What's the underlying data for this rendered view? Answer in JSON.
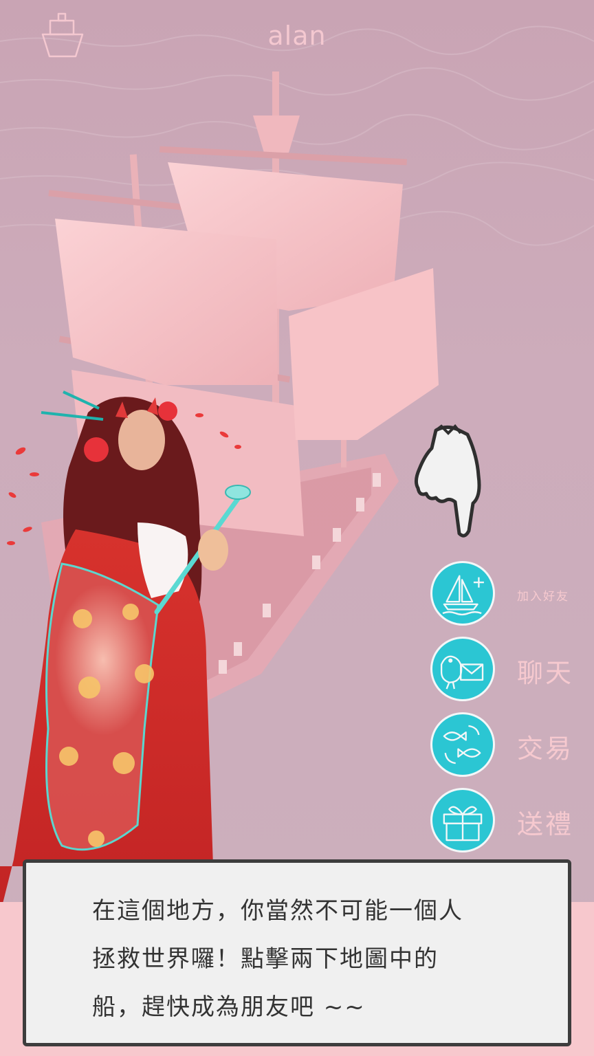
{
  "header": {
    "player_name": "alan"
  },
  "actions": [
    {
      "id": "add-friend",
      "label": "加入好友",
      "icon": "sailboat-plus-icon"
    },
    {
      "id": "chat",
      "label": "聊天",
      "icon": "pigeon-letter-icon"
    },
    {
      "id": "trade",
      "label": "交易",
      "icon": "fish-exchange-icon"
    },
    {
      "id": "gift",
      "label": "送禮",
      "icon": "gift-box-icon"
    }
  ],
  "dialog": {
    "lines": [
      "在這個地方，你當然不可能一個人",
      "拯救世界囉！點擊兩下地圖中的",
      "船，趕快成為朋友吧 ~~"
    ]
  },
  "colors": {
    "sea": "#cfb0bd",
    "sail": "#f9c9cc",
    "accent_teal": "#2bc6d3",
    "label_pink": "#f6c9cf",
    "dialog_bg": "#f0f0f0",
    "dialog_border": "#3d3d3d"
  }
}
